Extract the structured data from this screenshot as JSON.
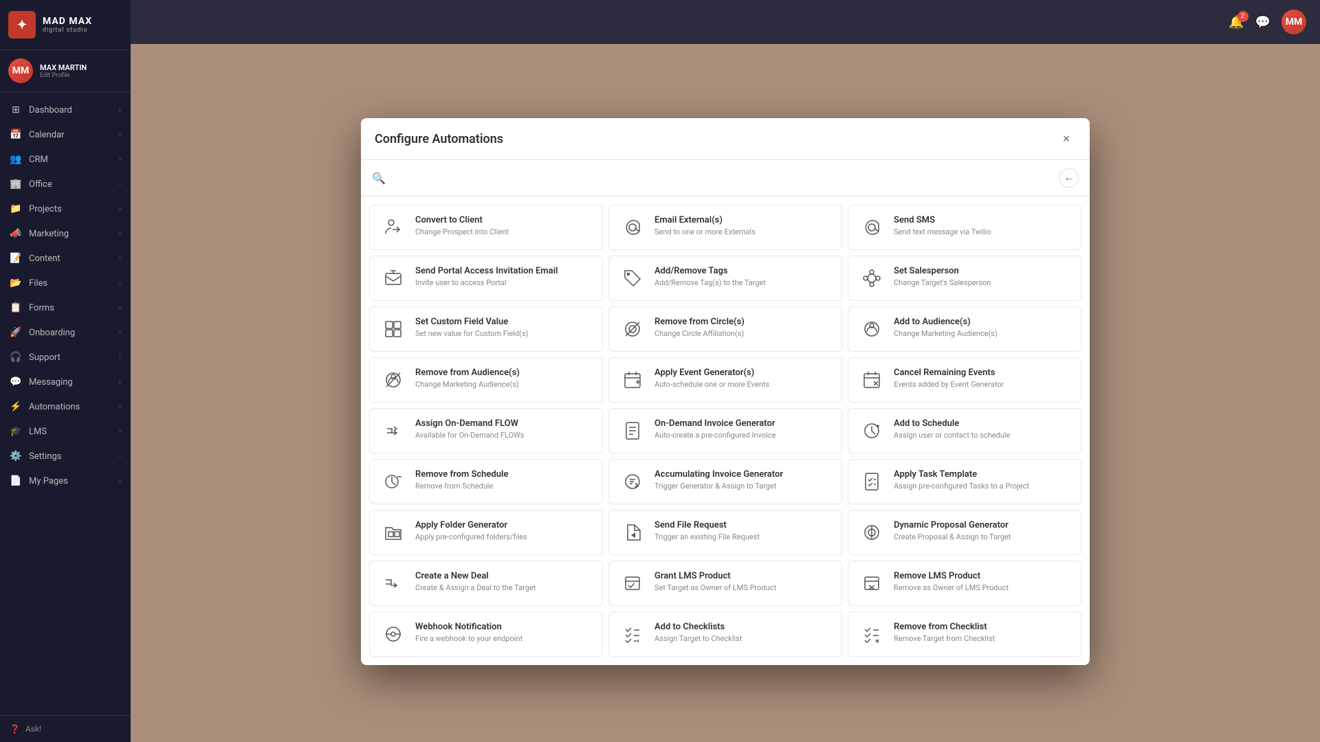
{
  "app": {
    "name": "MAD MAX",
    "subtitle": "digital studio"
  },
  "user": {
    "name": "MAX MARTIN",
    "edit_profile": "Edit Profile",
    "initials": "MM"
  },
  "sidebar": {
    "items": [
      {
        "id": "dashboard",
        "label": "Dashboard",
        "icon": "⊞",
        "hasChevron": true
      },
      {
        "id": "calendar",
        "label": "Calendar",
        "icon": "📅",
        "hasChevron": true
      },
      {
        "id": "crm",
        "label": "CRM",
        "icon": "👥",
        "hasChevron": true
      },
      {
        "id": "office",
        "label": "Office",
        "icon": "🏢",
        "hasChevron": true
      },
      {
        "id": "projects",
        "label": "Projects",
        "icon": "📁",
        "hasChevron": true
      },
      {
        "id": "marketing",
        "label": "Marketing",
        "icon": "📣",
        "hasChevron": true
      },
      {
        "id": "content",
        "label": "Content",
        "icon": "📝",
        "hasChevron": true
      },
      {
        "id": "files",
        "label": "Files",
        "icon": "📂",
        "hasChevron": true
      },
      {
        "id": "forms",
        "label": "Forms",
        "icon": "📋",
        "hasChevron": true
      },
      {
        "id": "onboarding",
        "label": "Onboarding",
        "icon": "🚀",
        "hasChevron": true
      },
      {
        "id": "support",
        "label": "Support",
        "icon": "🎧",
        "hasChevron": true
      },
      {
        "id": "messaging",
        "label": "Messaging",
        "icon": "💬",
        "hasChevron": true
      },
      {
        "id": "automations",
        "label": "Automations",
        "icon": "⚡",
        "hasChevron": true
      },
      {
        "id": "lms",
        "label": "LMS",
        "icon": "🎓",
        "hasChevron": true
      },
      {
        "id": "settings",
        "label": "Settings",
        "icon": "⚙️",
        "hasChevron": true
      },
      {
        "id": "my-pages",
        "label": "My Pages",
        "icon": "📄",
        "hasChevron": true
      }
    ],
    "ask_label": "Ask!"
  },
  "modal": {
    "title": "Configure Automations",
    "search_placeholder": "",
    "close_label": "×",
    "back_label": "←",
    "automations": [
      {
        "id": "convert-to-client",
        "title": "Convert to Client",
        "description": "Change Prospect into Client",
        "icon": "person-convert"
      },
      {
        "id": "email-externals",
        "title": "Email External(s)",
        "description": "Send to one or more Externals",
        "icon": "email-at"
      },
      {
        "id": "send-sms",
        "title": "Send SMS",
        "description": "Send text message via Twilio",
        "icon": "sms-at"
      },
      {
        "id": "send-portal-invitation",
        "title": "Send Portal Access Invitation Email",
        "description": "Invite user to access Portal",
        "icon": "portal-email"
      },
      {
        "id": "add-remove-tags",
        "title": "Add/Remove Tags",
        "description": "Add/Remove Tag(s) to the Target",
        "icon": "tag"
      },
      {
        "id": "set-salesperson",
        "title": "Set Salesperson",
        "description": "Change Target's Salesperson",
        "icon": "salesperson"
      },
      {
        "id": "set-custom-field",
        "title": "Set Custom Field Value",
        "description": "Set new value for Custom Field(s)",
        "icon": "custom-field"
      },
      {
        "id": "remove-from-circle",
        "title": "Remove from Circle(s)",
        "description": "Change Circle Affiliation(s)",
        "icon": "circle-remove"
      },
      {
        "id": "add-to-audiences",
        "title": "Add to Audience(s)",
        "description": "Change Marketing Audience(s)",
        "icon": "audience-add"
      },
      {
        "id": "remove-from-audiences",
        "title": "Remove from Audience(s)",
        "description": "Change Marketing Audience(s)",
        "icon": "audience-remove"
      },
      {
        "id": "apply-event-generator",
        "title": "Apply Event Generator(s)",
        "description": "Auto-schedule one or more Events",
        "icon": "event-generator"
      },
      {
        "id": "cancel-remaining-events",
        "title": "Cancel Remaining Events",
        "description": "Events added by Event Generator",
        "icon": "cancel-events"
      },
      {
        "id": "assign-on-demand-flow",
        "title": "Assign On-Demand FLOW",
        "description": "Available for On-Demand FLOWs",
        "icon": "flow"
      },
      {
        "id": "on-demand-invoice",
        "title": "On-Demand Invoice Generator",
        "description": "Auto-create a pre-configured Invoice",
        "icon": "invoice"
      },
      {
        "id": "add-to-schedule",
        "title": "Add to Schedule",
        "description": "Assign user or contact to schedule",
        "icon": "schedule-add"
      },
      {
        "id": "remove-from-schedule",
        "title": "Remove from Schedule",
        "description": "Remove from Schedule",
        "icon": "schedule-remove"
      },
      {
        "id": "accumulating-invoice",
        "title": "Accumulating Invoice Generator",
        "description": "Trigger Generator & Assign to Target",
        "icon": "invoice-accumulate"
      },
      {
        "id": "apply-task-template",
        "title": "Apply Task Template",
        "description": "Assign pre-configured Tasks to a Project",
        "icon": "task-template"
      },
      {
        "id": "apply-folder-generator",
        "title": "Apply Folder Generator",
        "description": "Apply pre-configured folders/files",
        "icon": "folder-generator"
      },
      {
        "id": "send-file-request",
        "title": "Send File Request",
        "description": "Trigger an existing File Request",
        "icon": "file-request"
      },
      {
        "id": "dynamic-proposal",
        "title": "Dynamic Proposal Generator",
        "description": "Create Proposal & Assign to Target",
        "icon": "proposal"
      },
      {
        "id": "create-new-deal",
        "title": "Create a New Deal",
        "description": "Create & Assign a Deal to the Target",
        "icon": "deal"
      },
      {
        "id": "grant-lms-product",
        "title": "Grant LMS Product",
        "description": "Set Target as Owner of LMS Product",
        "icon": "lms-grant"
      },
      {
        "id": "remove-lms-product",
        "title": "Remove LMS Product",
        "description": "Remove as Owner of LMS Product",
        "icon": "lms-remove"
      },
      {
        "id": "webhook-notification",
        "title": "Webhook Notification",
        "description": "Fire a webhook to your endpoint",
        "icon": "webhook"
      },
      {
        "id": "add-to-checklists",
        "title": "Add to Checklists",
        "description": "Assign Target to Checklist",
        "icon": "checklist-add"
      },
      {
        "id": "remove-from-checklist",
        "title": "Remove from Checklist",
        "description": "Remove Target from Checklist",
        "icon": "checklist-remove"
      }
    ]
  },
  "icons": {
    "person-convert": "👤",
    "email-at": "@",
    "sms-at": "@",
    "portal-email": "✉",
    "tag": "🏷",
    "salesperson": "⬡",
    "custom-field": "⊟",
    "circle-remove": "◎",
    "audience-add": "◉",
    "audience-remove": "◎",
    "event-generator": "📆",
    "cancel-events": "📅",
    "flow": "≫",
    "invoice": "📄",
    "schedule-add": "🕐",
    "schedule-remove": "🕐",
    "invoice-accumulate": "⚙",
    "task-template": "✓",
    "folder-generator": "⊞",
    "file-request": "▶",
    "proposal": "⚙",
    "deal": "≫",
    "lms-grant": "📋",
    "lms-remove": "📋",
    "webhook": "↺",
    "checklist-add": "✓",
    "checklist-remove": "✓"
  }
}
